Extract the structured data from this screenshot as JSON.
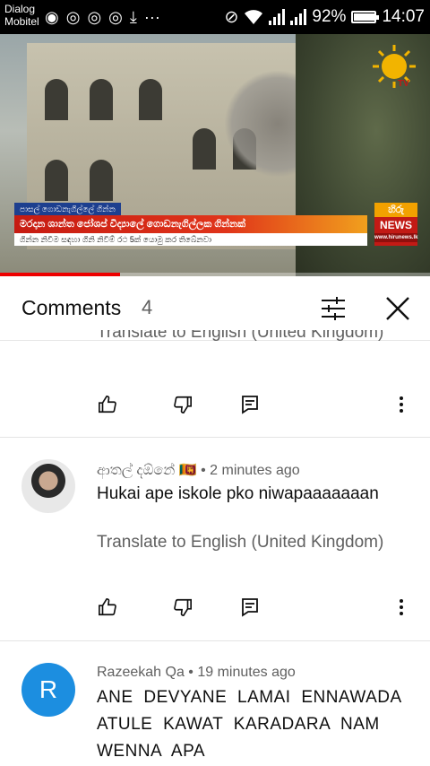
{
  "status_bar": {
    "carrier_line1": "Dialog",
    "carrier_line2": "Mobitel",
    "battery_percent": "92%",
    "battery_level": 0.92,
    "time": "14:07"
  },
  "video": {
    "ticker_tag": "පාසල් ගොඩනැගිල්ලේ ගින්න",
    "ticker_headline": "මරදාන ශාන්ත ජෝශප් විද්‍යාලේ ගොඩනැගිල්ලක ගින්නක්",
    "ticker_sub": "ගින්න නිවීම සඳහා ගිනි නිවීම් රථ 5ක් යොමු කර තිබේනවා",
    "badge_top": "හිරු",
    "badge_mid": "NEWS",
    "badge_url": "www.hirunews.lk",
    "logo_text": "TV",
    "progress_fraction": 0.28
  },
  "comments_header": {
    "title": "Comments",
    "count": "4"
  },
  "partial_comment": {
    "translate_label": "Translate to English (United Kingdom)"
  },
  "comments": [
    {
      "author": "ආතල් දඕනේ 🇱🇰",
      "time": "2 minutes ago",
      "text": "Hukai ape iskole pko niwapaaaaaaan",
      "translate_label": "Translate to English (United Kingdom)"
    },
    {
      "author": "Razeekah Qa",
      "avatar_letter": "R",
      "time": "19 minutes ago",
      "text": "ANE DEVYANE LAMAI ENNAWADA ATULE KAWAT KARADARA NAM WENNA APA"
    }
  ],
  "meta_separator": "•",
  "colors": {
    "accent_red": "#e00000",
    "avatar_blue": "#1c8ee0",
    "text_primary": "#0f0f0f",
    "text_secondary": "#606060"
  }
}
